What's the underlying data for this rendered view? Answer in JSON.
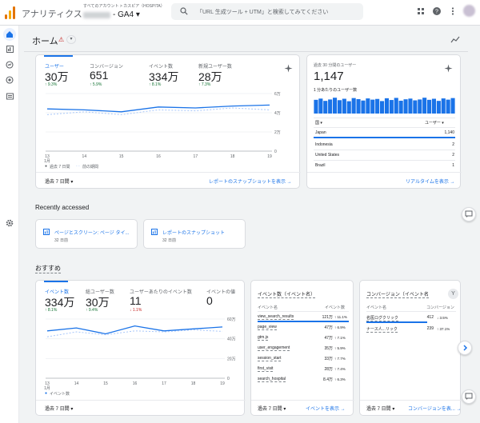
{
  "topbar": {
    "app_title": "アナリティクス",
    "account_path": "すべてのアカウント > カスピア（HOSPITA）",
    "property": "- GA4 ▾",
    "search_placeholder": "「URL 生成ツール + UTM」と検索してみてください"
  },
  "home": {
    "title": "ホーム",
    "warning": "⚠",
    "dropdown": "▾"
  },
  "main_card": {
    "metrics": [
      {
        "label": "ユーザー",
        "value": "30万",
        "change": "↑ 9.3%"
      },
      {
        "label": "コンバージョン",
        "value": "651",
        "change": "↑ 5.9%"
      },
      {
        "label": "イベント数",
        "value": "334万",
        "change": "↑ 8.1%"
      },
      {
        "label": "新規ユーザー数",
        "value": "28万",
        "change": "↑ 7.3%"
      }
    ],
    "y_ticks": [
      "6万",
      "4万",
      "2万",
      "0"
    ],
    "x_ticks": [
      "13",
      "14",
      "15",
      "16",
      "17",
      "18",
      "19"
    ],
    "x_month": "1月",
    "legend_current": "過去 7 日間",
    "legend_previous": "前の期間",
    "date_range": "過去 7 日間 ▾",
    "snapshot_link": "レポートのスナップショットを表示  →"
  },
  "main_chart_data": {
    "type": "line",
    "x": [
      "13",
      "14",
      "15",
      "16",
      "17",
      "18",
      "19"
    ],
    "series": [
      {
        "name": "過去 7 日間",
        "values": [
          44000,
          43000,
          41000,
          46000,
          45000,
          47000,
          48000
        ]
      },
      {
        "name": "前の期間",
        "values": [
          38000,
          41000,
          38000,
          43000,
          42000,
          45000,
          43000
        ]
      }
    ],
    "ylim": [
      0,
      60000
    ]
  },
  "realtime_card": {
    "title": "過去 30 分間のユーザー",
    "value": "1,147",
    "subtitle": "1 分あたりのユーザー数",
    "col_head_left": "国 ▾",
    "col_head_right": "ユーザー ▾",
    "rows": [
      {
        "country": "Japan",
        "users": "1,140"
      },
      {
        "country": "Indonesia",
        "users": "2"
      },
      {
        "country": "United States",
        "users": "2"
      },
      {
        "country": "Brazil",
        "users": "1"
      }
    ],
    "link": "リアルタイムを表示  →"
  },
  "realtime_bars": [
    78,
    85,
    72,
    80,
    90,
    76,
    84,
    70,
    88,
    82,
    74,
    86,
    79,
    83,
    71,
    87,
    77,
    89,
    73,
    81,
    85,
    75,
    80,
    90,
    78,
    84,
    72,
    86,
    79,
    88
  ],
  "recent": {
    "title": "Recently accessed",
    "items": [
      {
        "title": "ページとスクリーン: ページ タイ...",
        "sub": "32 日前"
      },
      {
        "title": "レポートのスナップショット",
        "sub": "32 日前"
      }
    ]
  },
  "recommend": {
    "title": "おすすめ"
  },
  "rec_main": {
    "metrics": [
      {
        "label": "イベント数",
        "value": "334万",
        "change": "↑ 8.1%"
      },
      {
        "label": "総ユーザー数",
        "value": "30万",
        "change": "↑ 9.4%"
      },
      {
        "label": "ユーザーあたりのイベント数",
        "value": "11",
        "change": "↓ 1.1%"
      },
      {
        "label": "イベントの値",
        "value": "0",
        "change": ""
      }
    ],
    "y_ticks": [
      "60万",
      "40万",
      "20万",
      "0"
    ],
    "x_ticks": [
      "13",
      "14",
      "15",
      "16",
      "17",
      "18",
      "19"
    ],
    "x_month": "1月",
    "legend": "イベント数",
    "date_range": "過去 7 日間 ▾"
  },
  "rec_chart_data": {
    "type": "line",
    "x": [
      "13",
      "14",
      "15",
      "16",
      "17",
      "18",
      "19"
    ],
    "series": [
      {
        "name": "イベント数",
        "values": [
          480000,
          510000,
          450000,
          530000,
          480000,
          500000,
          520000
        ]
      },
      {
        "name": "",
        "values": [
          420000,
          470000,
          440000,
          480000,
          470000,
          490000,
          475000
        ]
      }
    ],
    "ylim": [
      0,
      600000
    ]
  },
  "events_card": {
    "title": "イベント数（イベント名）",
    "col_left": "イベント名",
    "col_right": "イベント数",
    "rows": [
      {
        "name": "view_search_results",
        "value": "121万",
        "change": "↑ 11.1%",
        "dir": "up"
      },
      {
        "name": "page_view",
        "value": "47万",
        "change": "↑ 6.9%",
        "dir": "up"
      },
      {
        "name": "gtm.js",
        "value": "47万",
        "change": "↑ 7.1%",
        "dir": "up"
      },
      {
        "name": "user_engagement",
        "value": "35万",
        "change": "↑ 5.9%",
        "dir": "up"
      },
      {
        "name": "session_start",
        "value": "33万",
        "change": "↑ 7.7%",
        "dir": "up"
      },
      {
        "name": "first_visit",
        "value": "28万",
        "change": "↑ 7.4%",
        "dir": "up"
      },
      {
        "name": "search_hospital",
        "value": "8.4万",
        "change": "↑ 6.3%",
        "dir": "up"
      }
    ],
    "date_range": "過去 7 日間 ▾",
    "link": "イベントを表示  →"
  },
  "conv_card": {
    "title": "コンバージョン（イベント名",
    "col_left": "イベント名",
    "col_right": "コンバージョン",
    "rows": [
      {
        "name": "名医ログクリック",
        "value": "412",
        "change": "↓ 3.5%",
        "dir": "down"
      },
      {
        "name": "ナース人...リック",
        "value": "239",
        "change": "↑ 37.1%",
        "dir": "up"
      }
    ],
    "date_range": "過去 7 日間 ▾",
    "link": "コンバージョンを表...  →"
  },
  "colors": {
    "accent": "#1a73e8",
    "up": "#137333",
    "down": "#c5221f",
    "prev_line": "#a8c7fa"
  }
}
